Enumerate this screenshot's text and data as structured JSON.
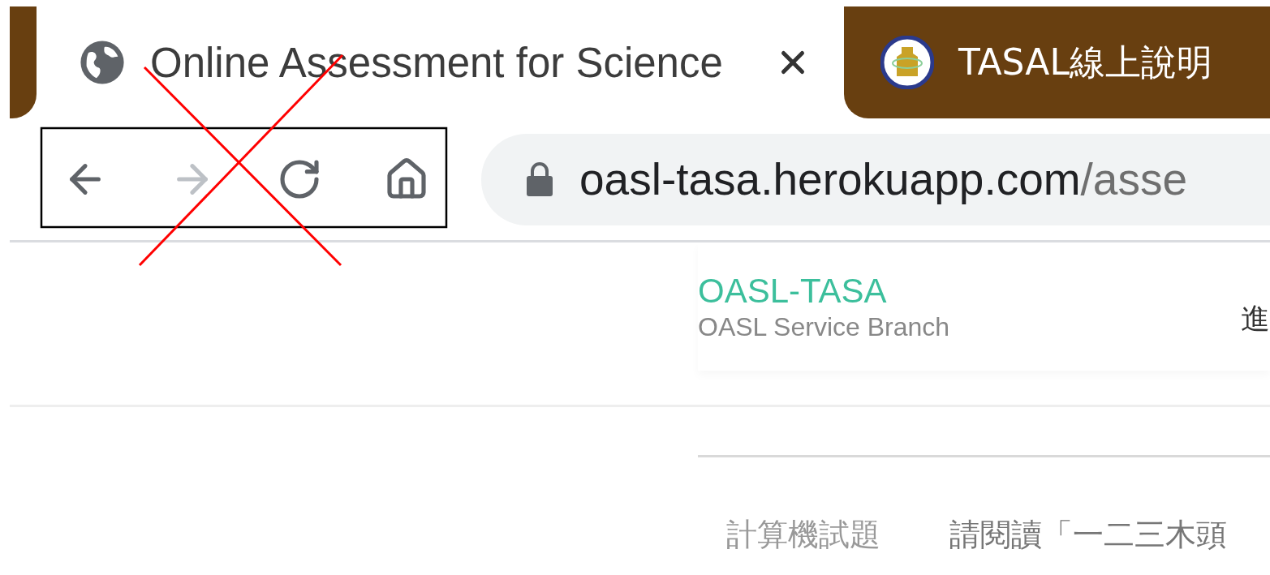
{
  "tabs": [
    {
      "title": "Online Assessment for Science",
      "selected": true
    },
    {
      "title": "TASAL線上說明",
      "selected": false
    }
  ],
  "toolbar": {
    "buttons": [
      {
        "kind": "back",
        "disabled": false
      },
      {
        "kind": "forward",
        "disabled": true
      },
      {
        "kind": "reload",
        "disabled": false
      },
      {
        "kind": "home",
        "disabled": false
      }
    ]
  },
  "address_bar": {
    "host": "oasl-tasa.herokuapp.com",
    "path": "/asse"
  },
  "header": {
    "title": "OASL-TASA",
    "subtitle": "OASL Service Branch",
    "nav_item": "進"
  },
  "content": {
    "label": "計算機試題",
    "text": "請閱讀「一二三木頭"
  }
}
